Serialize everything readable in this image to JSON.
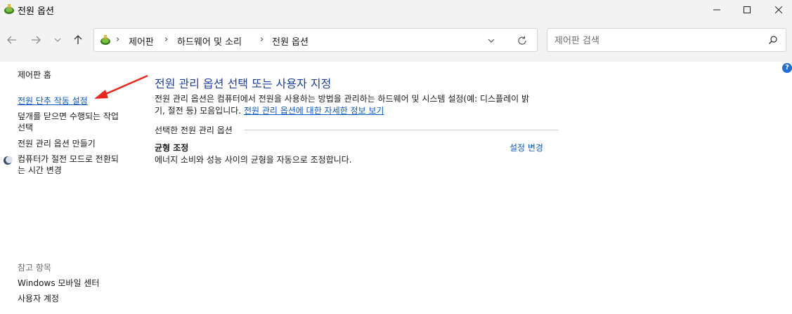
{
  "window": {
    "title": "전원 옵션"
  },
  "address_bar": {
    "crumbs": [
      "제어판",
      "하드웨어 및 소리",
      "전원 옵션"
    ],
    "separator": "›"
  },
  "search": {
    "placeholder": "제어판 검색"
  },
  "help": {
    "label": "?"
  },
  "sidebar": {
    "home": "제어판 홈",
    "items": [
      "전원 단추 작동 설정",
      "덮개를 닫으면 수행되는 작업",
      "선택",
      "전원 관리 옵션 만들기",
      "컴퓨터가 절전 모드로 전환되",
      "는 시간 변경"
    ],
    "see_also_title": "참고 항목",
    "see_also": [
      "Windows 모바일 센터",
      "사용자 계정"
    ]
  },
  "main": {
    "title": "전원 관리 옵션 선택 또는 사용자 지정",
    "description_line1": "전원 관리 옵션은 컴퓨터에서 전원을 사용하는 방법을 관리하는 하드웨어 및 시스템 설정(예: 디스플레이 밝",
    "description_line2": "기, 절전 등) 모음입니다. ",
    "description_link": "전원 관리 옵션에 대한 자세한 정보 보기",
    "section_title": "선택한 전원 관리 옵션",
    "plan": {
      "name": "균형 조정",
      "description": "에너지 소비와 성능 사이의 균형을 자동으로 조정합니다.",
      "change_label": "설정 변경"
    }
  },
  "colors": {
    "title_blue": "#1e3f9e",
    "link_blue": "#0b57c4",
    "annotation_red": "#e8281c"
  }
}
